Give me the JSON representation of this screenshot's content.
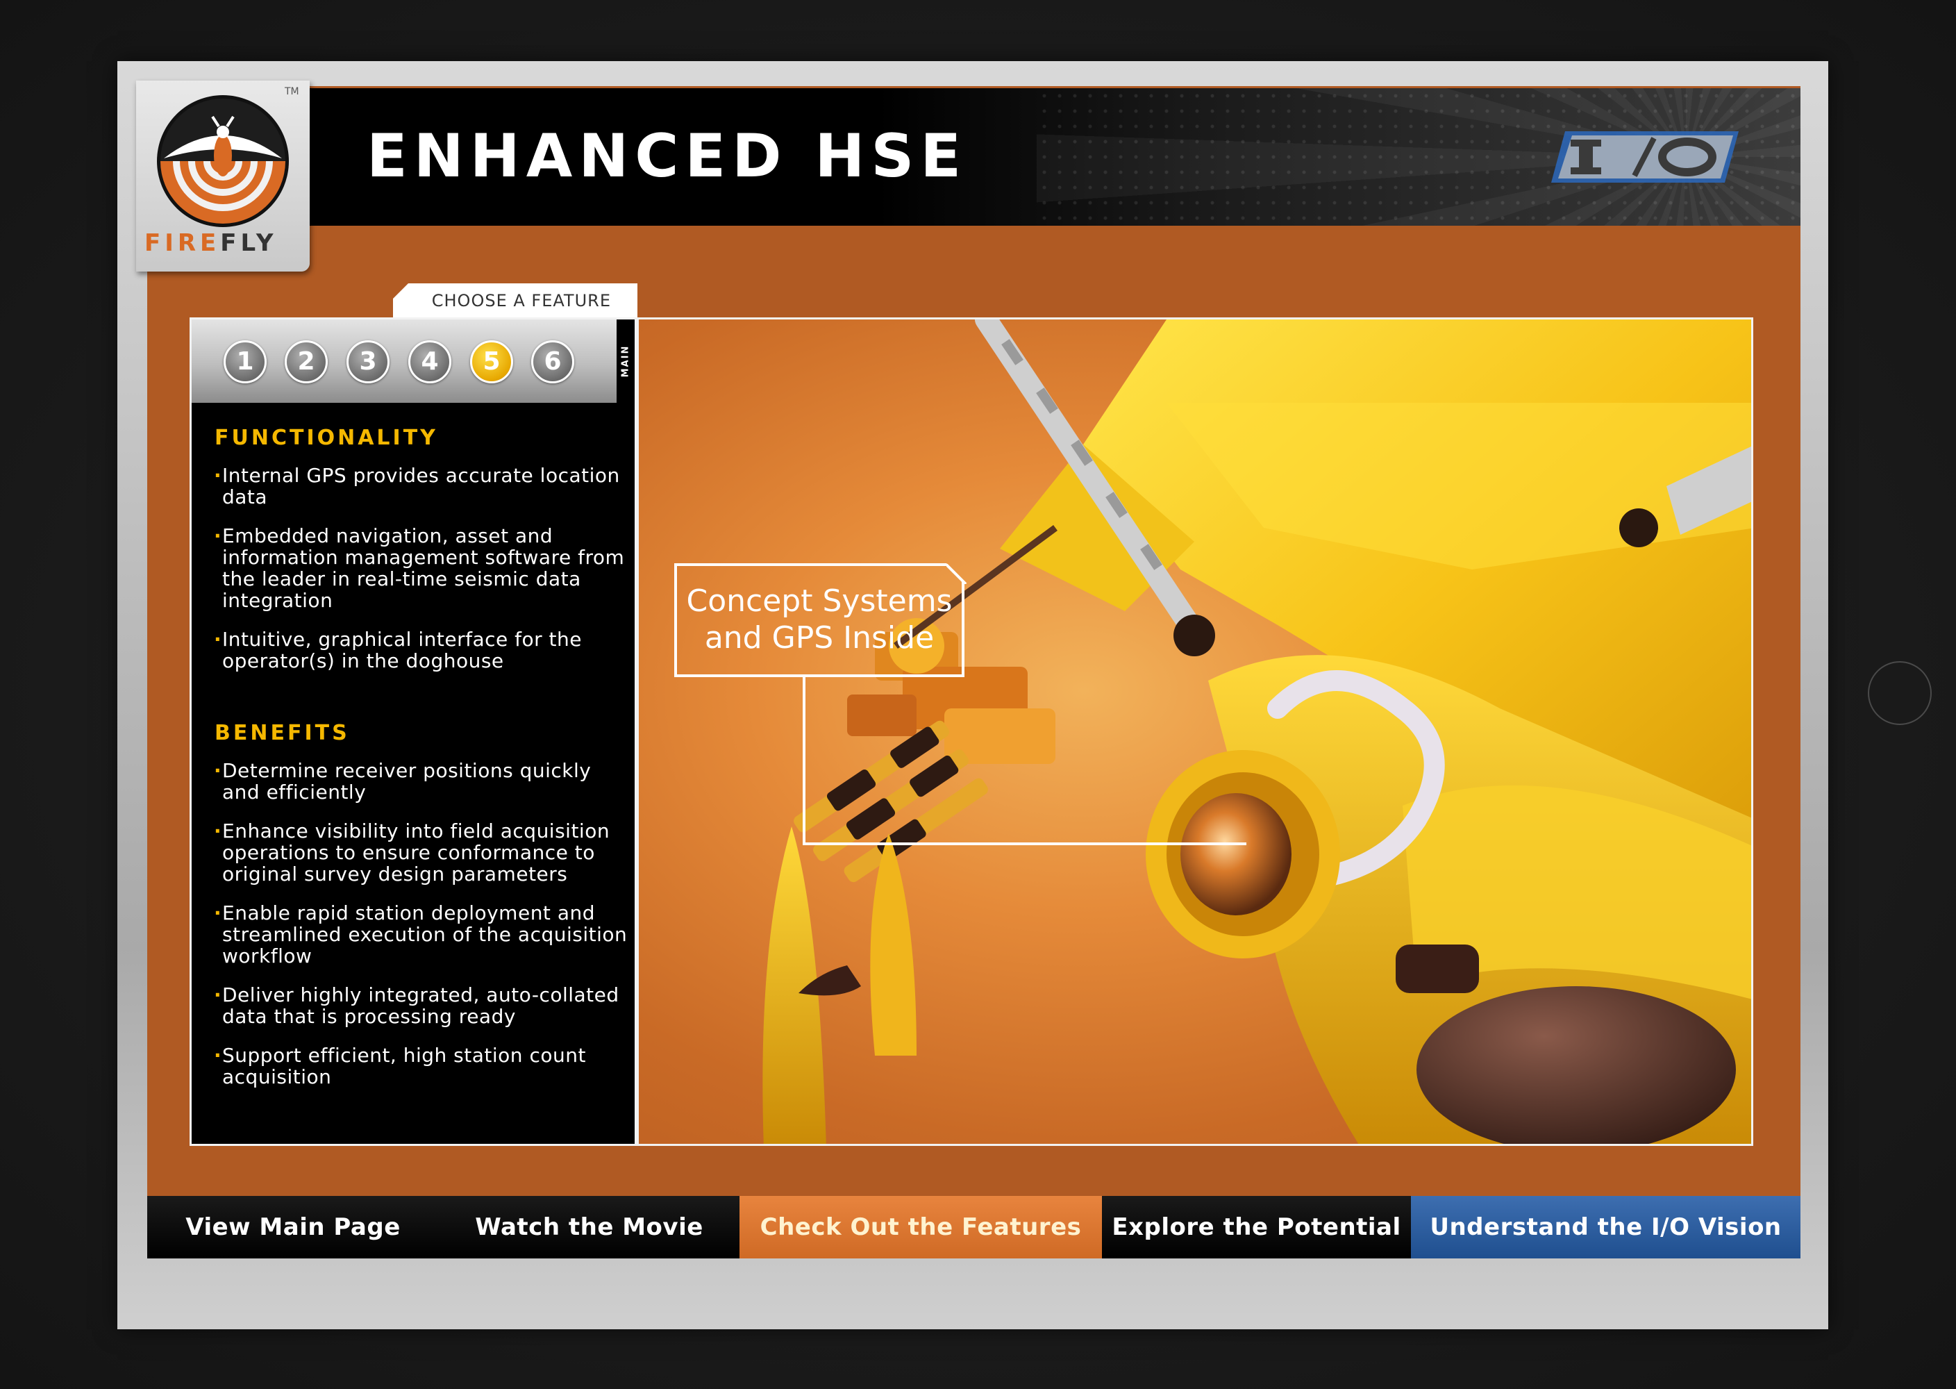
{
  "header": {
    "title": "ENHANCED HSE",
    "io_logo_text": "I/O",
    "tm": "TM"
  },
  "logo": {
    "word_fire": "FIRE",
    "word_fly": "FLY"
  },
  "features": {
    "tab_label": "CHOOSE A FEATURE",
    "numbers": [
      "1",
      "2",
      "3",
      "4",
      "5",
      "6"
    ],
    "active_index": 4,
    "main_label": "MAIN"
  },
  "functionality": {
    "heading": "FUNCTIONALITY",
    "items": [
      "Internal GPS provides accurate location data",
      "Embedded navigation, asset and information management software from the leader in real-time seismic data integration",
      "Intuitive, graphical interface for the operator(s) in the doghouse"
    ]
  },
  "benefits": {
    "heading": "BENEFITS",
    "items": [
      "Determine receiver positions quickly and efficiently",
      "Enhance visibility into field acquisition operations to ensure conformance to original survey design parameters",
      "Enable rapid station deployment and streamlined execution of the acquisition workflow",
      "Deliver highly integrated, auto-collated data that is processing ready",
      "Support efficient, high station count acquisition"
    ]
  },
  "callout": {
    "line1": "Concept Systems",
    "line2": "and GPS Inside"
  },
  "bottom_nav": [
    {
      "label": "View Main Page"
    },
    {
      "label": "Watch the Movie"
    },
    {
      "label": "Check Out the Features"
    },
    {
      "label": "Explore the Potential"
    },
    {
      "label": "Understand the I/O Vision"
    }
  ],
  "colors": {
    "accent_orange": "#b05a23",
    "highlight_yellow": "#f5b800",
    "active_nav": "#cf6a25",
    "vision_blue": "#1f4f8f"
  },
  "icons": {
    "logo": "firefly-logo-icon",
    "io": "io-logo-icon",
    "robot": "firefly-robot-illustration"
  }
}
